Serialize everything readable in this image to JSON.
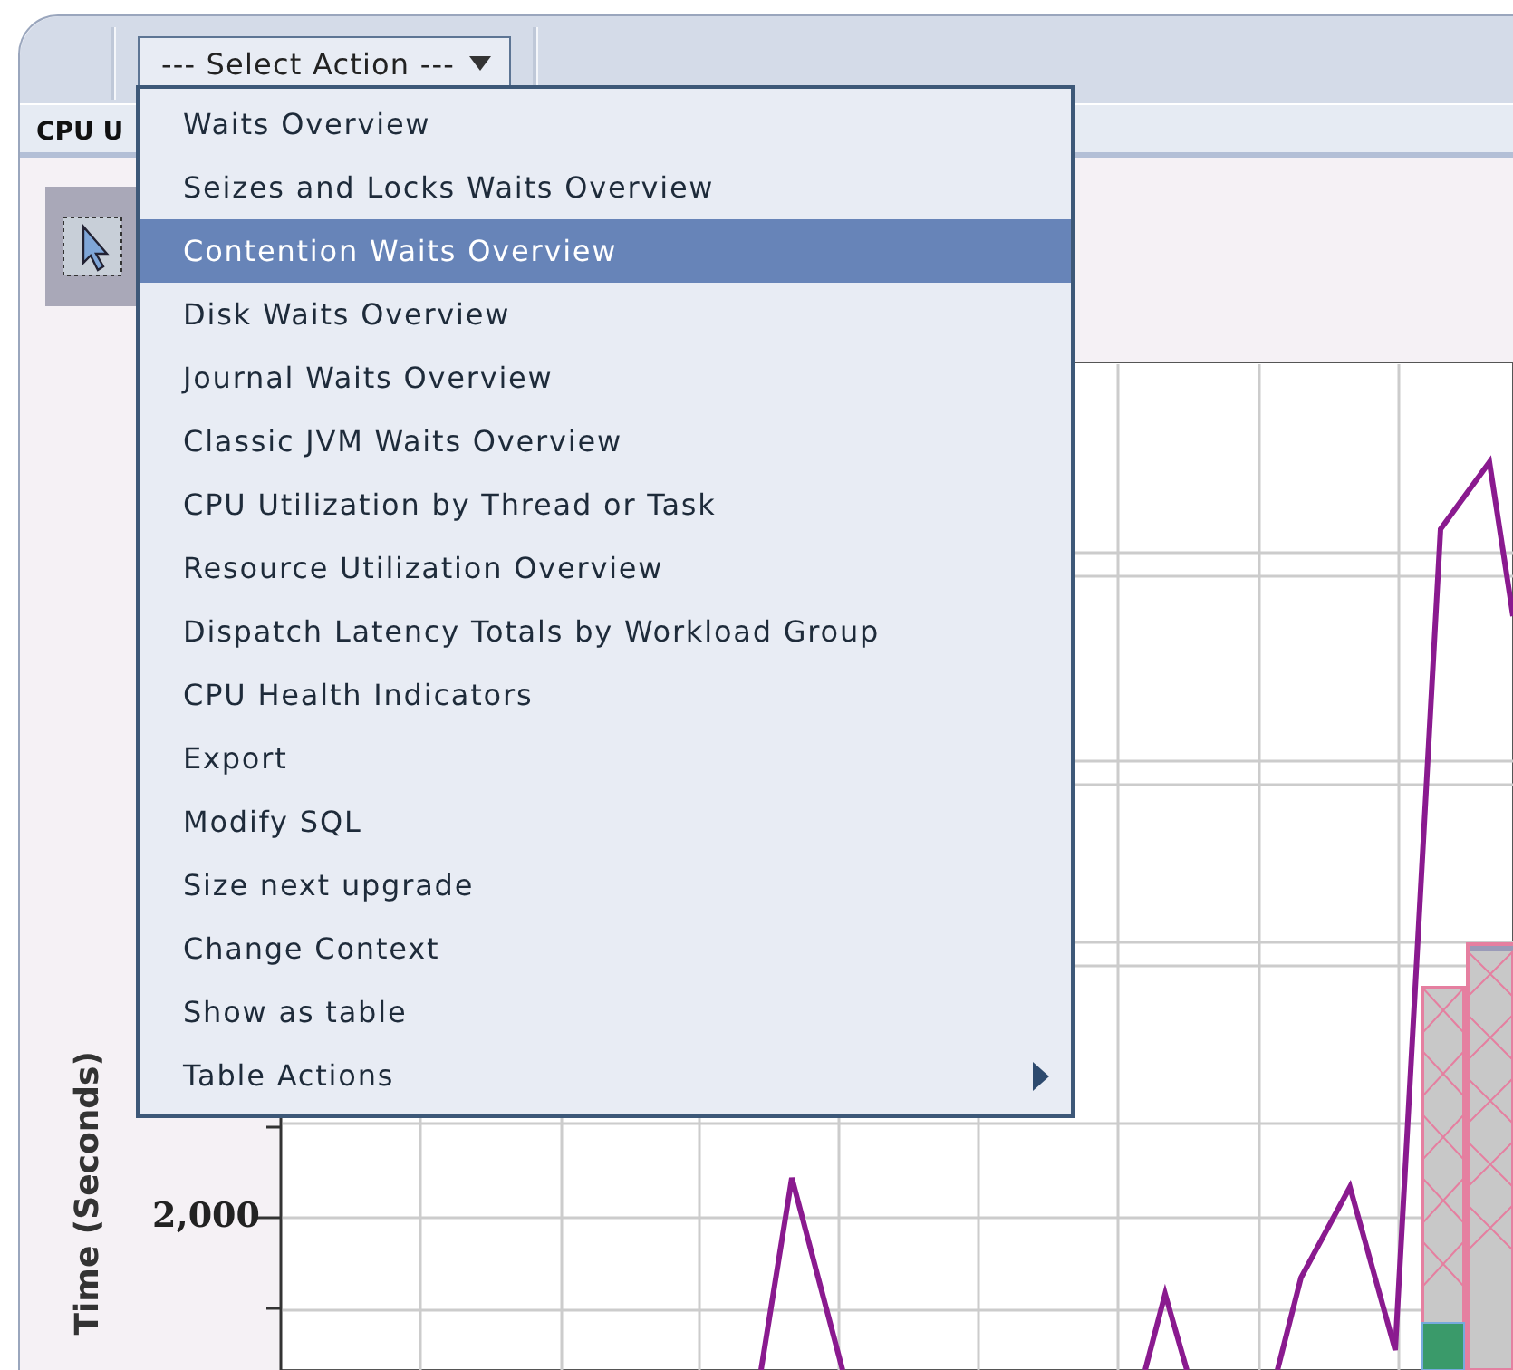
{
  "toolbar": {
    "select_label": "--- Select Action ---"
  },
  "tab": {
    "label": "CPU U"
  },
  "menu": {
    "items": [
      {
        "label": "Waits Overview",
        "kind": "item",
        "selected": false
      },
      {
        "label": "Seizes and Locks Waits Overview",
        "kind": "item",
        "selected": false
      },
      {
        "label": "Contention Waits Overview",
        "kind": "item",
        "selected": true
      },
      {
        "label": "Disk Waits Overview",
        "kind": "item",
        "selected": false
      },
      {
        "label": "Journal Waits Overview",
        "kind": "item",
        "selected": false
      },
      {
        "label": "Classic JVM Waits Overview",
        "kind": "item",
        "selected": false
      },
      {
        "label": "CPU Utilization by Thread or Task",
        "kind": "item",
        "selected": false
      },
      {
        "label": "Resource Utilization Overview",
        "kind": "item",
        "selected": false
      },
      {
        "label": "Dispatch Latency Totals by Workload Group",
        "kind": "item",
        "selected": false
      },
      {
        "label": "CPU Health Indicators",
        "kind": "item",
        "selected": false
      },
      {
        "label": "Export",
        "kind": "item",
        "selected": false
      },
      {
        "label": "Modify SQL",
        "kind": "item",
        "selected": false
      },
      {
        "label": "Size next upgrade",
        "kind": "item",
        "selected": false
      },
      {
        "label": "Change Context",
        "kind": "item",
        "selected": false
      },
      {
        "label": "Show as table",
        "kind": "item",
        "selected": false
      },
      {
        "label": "Table Actions",
        "kind": "submenu",
        "selected": false
      }
    ]
  },
  "chart": {
    "y_axis_title": "Time (Seconds)",
    "tick_label": "2,000"
  }
}
